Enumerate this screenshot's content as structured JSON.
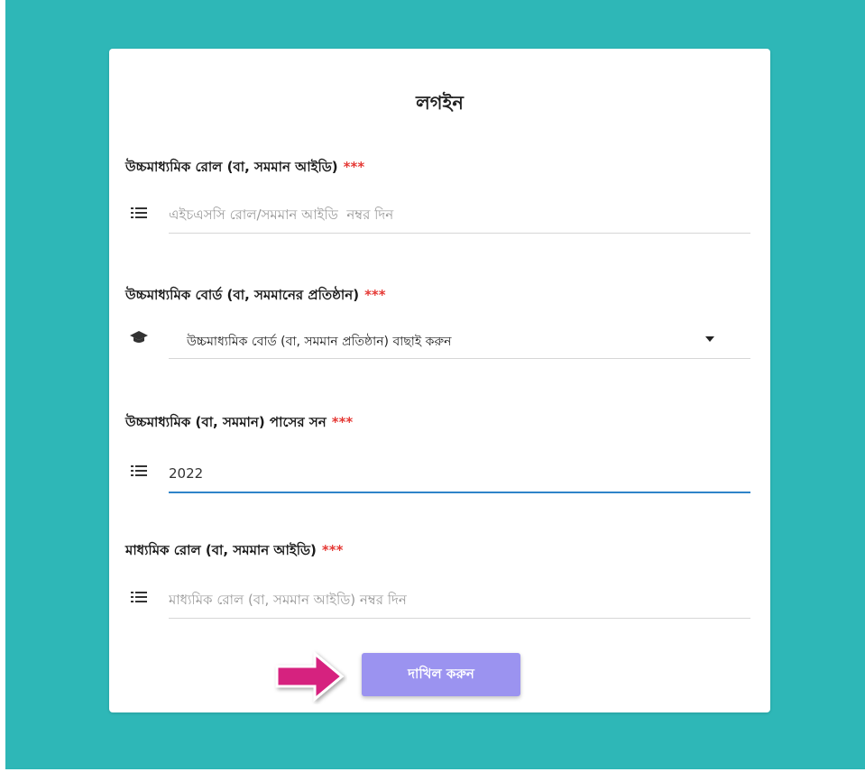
{
  "form": {
    "title": "লগইন",
    "required_mark": "***",
    "fields": [
      {
        "label": "উচ্চমাধ্যমিক রোল (বা, সমমান আইডি)",
        "icon": "list-icon",
        "type": "text",
        "value": "",
        "placeholder": "এইচএসসি রোল/সমমান আইডি  নম্বর দিন"
      },
      {
        "label": "উচ্চমাধ্যমিক বোর্ড (বা, সমমানের প্রতিষ্ঠান)",
        "icon": "graduation-cap-icon",
        "type": "select",
        "selected": "উচ্চমাধ্যমিক বোর্ড (বা, সমমান প্রতিষ্ঠান) বাছাই করুন"
      },
      {
        "label": "উচ্চমাধ্যমিক (বা, সমমান) পাসের সন",
        "icon": "list-icon",
        "type": "text",
        "value": "2022",
        "placeholder": ""
      },
      {
        "label": "মাধ্যমিক রোল (বা, সমমান আইডি)",
        "icon": "list-icon",
        "type": "text",
        "value": "",
        "placeholder": "মাধ্যমিক রোল (বা, সমমান আইডি) নম্বর দিন"
      }
    ],
    "submit_label": "দাখিল করুন"
  },
  "colors": {
    "background": "#2eb7b7",
    "submit": "#9b93f0",
    "required": "#e53935",
    "active_underline": "#2f84c9",
    "pointer_arrow": "#d6237f"
  }
}
